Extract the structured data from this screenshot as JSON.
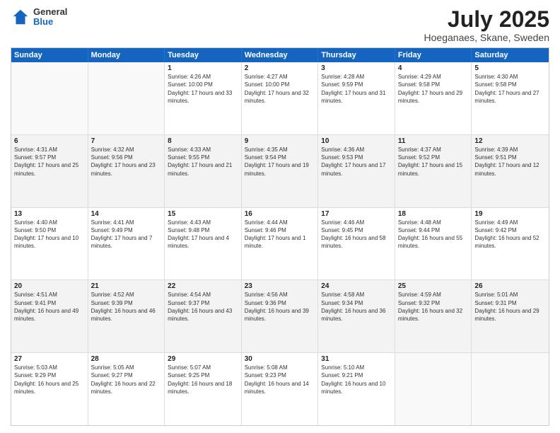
{
  "header": {
    "logo": {
      "general": "General",
      "blue": "Blue"
    },
    "title": "July 2025",
    "location": "Hoeganaes, Skane, Sweden"
  },
  "calendar": {
    "weekdays": [
      "Sunday",
      "Monday",
      "Tuesday",
      "Wednesday",
      "Thursday",
      "Friday",
      "Saturday"
    ],
    "rows": [
      [
        {
          "day": "",
          "info": ""
        },
        {
          "day": "",
          "info": ""
        },
        {
          "day": "1",
          "info": "Sunrise: 4:26 AM\nSunset: 10:00 PM\nDaylight: 17 hours and 33 minutes."
        },
        {
          "day": "2",
          "info": "Sunrise: 4:27 AM\nSunset: 10:00 PM\nDaylight: 17 hours and 32 minutes."
        },
        {
          "day": "3",
          "info": "Sunrise: 4:28 AM\nSunset: 9:59 PM\nDaylight: 17 hours and 31 minutes."
        },
        {
          "day": "4",
          "info": "Sunrise: 4:29 AM\nSunset: 9:58 PM\nDaylight: 17 hours and 29 minutes."
        },
        {
          "day": "5",
          "info": "Sunrise: 4:30 AM\nSunset: 9:58 PM\nDaylight: 17 hours and 27 minutes."
        }
      ],
      [
        {
          "day": "6",
          "info": "Sunrise: 4:31 AM\nSunset: 9:57 PM\nDaylight: 17 hours and 25 minutes."
        },
        {
          "day": "7",
          "info": "Sunrise: 4:32 AM\nSunset: 9:56 PM\nDaylight: 17 hours and 23 minutes."
        },
        {
          "day": "8",
          "info": "Sunrise: 4:33 AM\nSunset: 9:55 PM\nDaylight: 17 hours and 21 minutes."
        },
        {
          "day": "9",
          "info": "Sunrise: 4:35 AM\nSunset: 9:54 PM\nDaylight: 17 hours and 19 minutes."
        },
        {
          "day": "10",
          "info": "Sunrise: 4:36 AM\nSunset: 9:53 PM\nDaylight: 17 hours and 17 minutes."
        },
        {
          "day": "11",
          "info": "Sunrise: 4:37 AM\nSunset: 9:52 PM\nDaylight: 17 hours and 15 minutes."
        },
        {
          "day": "12",
          "info": "Sunrise: 4:39 AM\nSunset: 9:51 PM\nDaylight: 17 hours and 12 minutes."
        }
      ],
      [
        {
          "day": "13",
          "info": "Sunrise: 4:40 AM\nSunset: 9:50 PM\nDaylight: 17 hours and 10 minutes."
        },
        {
          "day": "14",
          "info": "Sunrise: 4:41 AM\nSunset: 9:49 PM\nDaylight: 17 hours and 7 minutes."
        },
        {
          "day": "15",
          "info": "Sunrise: 4:43 AM\nSunset: 9:48 PM\nDaylight: 17 hours and 4 minutes."
        },
        {
          "day": "16",
          "info": "Sunrise: 4:44 AM\nSunset: 9:46 PM\nDaylight: 17 hours and 1 minute."
        },
        {
          "day": "17",
          "info": "Sunrise: 4:46 AM\nSunset: 9:45 PM\nDaylight: 16 hours and 58 minutes."
        },
        {
          "day": "18",
          "info": "Sunrise: 4:48 AM\nSunset: 9:44 PM\nDaylight: 16 hours and 55 minutes."
        },
        {
          "day": "19",
          "info": "Sunrise: 4:49 AM\nSunset: 9:42 PM\nDaylight: 16 hours and 52 minutes."
        }
      ],
      [
        {
          "day": "20",
          "info": "Sunrise: 4:51 AM\nSunset: 9:41 PM\nDaylight: 16 hours and 49 minutes."
        },
        {
          "day": "21",
          "info": "Sunrise: 4:52 AM\nSunset: 9:39 PM\nDaylight: 16 hours and 46 minutes."
        },
        {
          "day": "22",
          "info": "Sunrise: 4:54 AM\nSunset: 9:37 PM\nDaylight: 16 hours and 43 minutes."
        },
        {
          "day": "23",
          "info": "Sunrise: 4:56 AM\nSunset: 9:36 PM\nDaylight: 16 hours and 39 minutes."
        },
        {
          "day": "24",
          "info": "Sunrise: 4:58 AM\nSunset: 9:34 PM\nDaylight: 16 hours and 36 minutes."
        },
        {
          "day": "25",
          "info": "Sunrise: 4:59 AM\nSunset: 9:32 PM\nDaylight: 16 hours and 32 minutes."
        },
        {
          "day": "26",
          "info": "Sunrise: 5:01 AM\nSunset: 9:31 PM\nDaylight: 16 hours and 29 minutes."
        }
      ],
      [
        {
          "day": "27",
          "info": "Sunrise: 5:03 AM\nSunset: 9:29 PM\nDaylight: 16 hours and 25 minutes."
        },
        {
          "day": "28",
          "info": "Sunrise: 5:05 AM\nSunset: 9:27 PM\nDaylight: 16 hours and 22 minutes."
        },
        {
          "day": "29",
          "info": "Sunrise: 5:07 AM\nSunset: 9:25 PM\nDaylight: 16 hours and 18 minutes."
        },
        {
          "day": "30",
          "info": "Sunrise: 5:08 AM\nSunset: 9:23 PM\nDaylight: 16 hours and 14 minutes."
        },
        {
          "day": "31",
          "info": "Sunrise: 5:10 AM\nSunset: 9:21 PM\nDaylight: 16 hours and 10 minutes."
        },
        {
          "day": "",
          "info": ""
        },
        {
          "day": "",
          "info": ""
        }
      ]
    ]
  }
}
